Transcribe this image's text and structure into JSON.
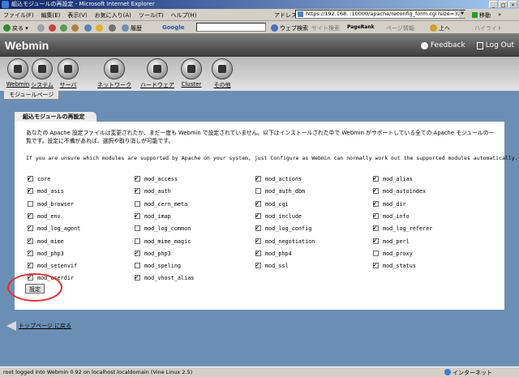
{
  "window": {
    "title": "組込モジュールの再設定 - Microsoft Internet Explorer"
  },
  "menu": [
    "ファイル(F)",
    "編集(E)",
    "表示(V)",
    "お気に入り(A)",
    "ツール(T)",
    "ヘルプ(H)"
  ],
  "address": {
    "label": "アドレス(D)",
    "url": "https://192.168.   :10000/apache/reconfig_form.cgi?size=323180",
    "go_label": "移動",
    "links_label": "»"
  },
  "toolbar": {
    "back": "戻る",
    "history": "履歴",
    "google": "Google",
    "web_search": "ウェブ検索",
    "site_search": "サイト検索",
    "pagerank": "PageRank",
    "page_info": "ページ情報",
    "up": "上へ",
    "highlight": "ハイライト"
  },
  "webmin": {
    "logo": "Webmin",
    "feedback": "Feedback",
    "logout": "Log Out"
  },
  "categories": [
    "Webmin",
    "システム",
    "サーバ",
    "ネットワーク",
    "ハードウェア",
    "Cluster",
    "その他"
  ],
  "module_tab": "モジュールページ",
  "panel": {
    "title": "組込モジュールの再設定",
    "desc_ja": "あなたの Apache 設定ファイルは変更されたか、まだ一度も Webmin で設定されていません。以下はインストールされた中で Webmin がサポートしている全ての Apache モジュールの一覧です。設定に不備があれば、選択や取り消しが可能です。",
    "desc_en": "If you are unsure which modules are supported by Apache on your system, just Configure as Webmin can normally work out the supported modules automatically.",
    "modules": [
      {
        "name": "core",
        "checked": true
      },
      {
        "name": "mod_access",
        "checked": true
      },
      {
        "name": "mod_actions",
        "checked": true
      },
      {
        "name": "mod_alias",
        "checked": true
      },
      {
        "name": "mod_asis",
        "checked": true
      },
      {
        "name": "mod_auth",
        "checked": true
      },
      {
        "name": "mod_auth_dbm",
        "checked": false
      },
      {
        "name": "mod_autoindex",
        "checked": true
      },
      {
        "name": "mod_browser",
        "checked": false
      },
      {
        "name": "mod_cern_meta",
        "checked": false
      },
      {
        "name": "mod_cgi",
        "checked": true
      },
      {
        "name": "mod_dir",
        "checked": true
      },
      {
        "name": "mod_env",
        "checked": true
      },
      {
        "name": "mod_imap",
        "checked": true
      },
      {
        "name": "mod_include",
        "checked": true
      },
      {
        "name": "mod_info",
        "checked": true
      },
      {
        "name": "mod_log_agent",
        "checked": true
      },
      {
        "name": "mod_log_common",
        "checked": false
      },
      {
        "name": "mod_log_config",
        "checked": true
      },
      {
        "name": "mod_log_referer",
        "checked": true
      },
      {
        "name": "mod_mime",
        "checked": true
      },
      {
        "name": "mod_mime_magic",
        "checked": false
      },
      {
        "name": "mod_negotiation",
        "checked": true
      },
      {
        "name": "mod_perl",
        "checked": true
      },
      {
        "name": "mod_php3",
        "checked": true
      },
      {
        "name": "mod_php3",
        "checked": true
      },
      {
        "name": "mod_php4",
        "checked": true
      },
      {
        "name": "mod_proxy",
        "checked": false
      },
      {
        "name": "mod_setenvif",
        "checked": true
      },
      {
        "name": "mod_speling",
        "checked": false
      },
      {
        "name": "mod_ssl",
        "checked": true
      },
      {
        "name": "mod_status",
        "checked": true
      },
      {
        "name": "mod_userdir",
        "checked": true
      },
      {
        "name": "mod_vhost_alias",
        "checked": true
      }
    ],
    "submit_label": "設定"
  },
  "back_link": "トップページ に戻る",
  "status": {
    "text": "root logged into Webmin 0.92 on localhost.localdomain (Vine Linux 2.5)",
    "zone": "インターネット"
  }
}
